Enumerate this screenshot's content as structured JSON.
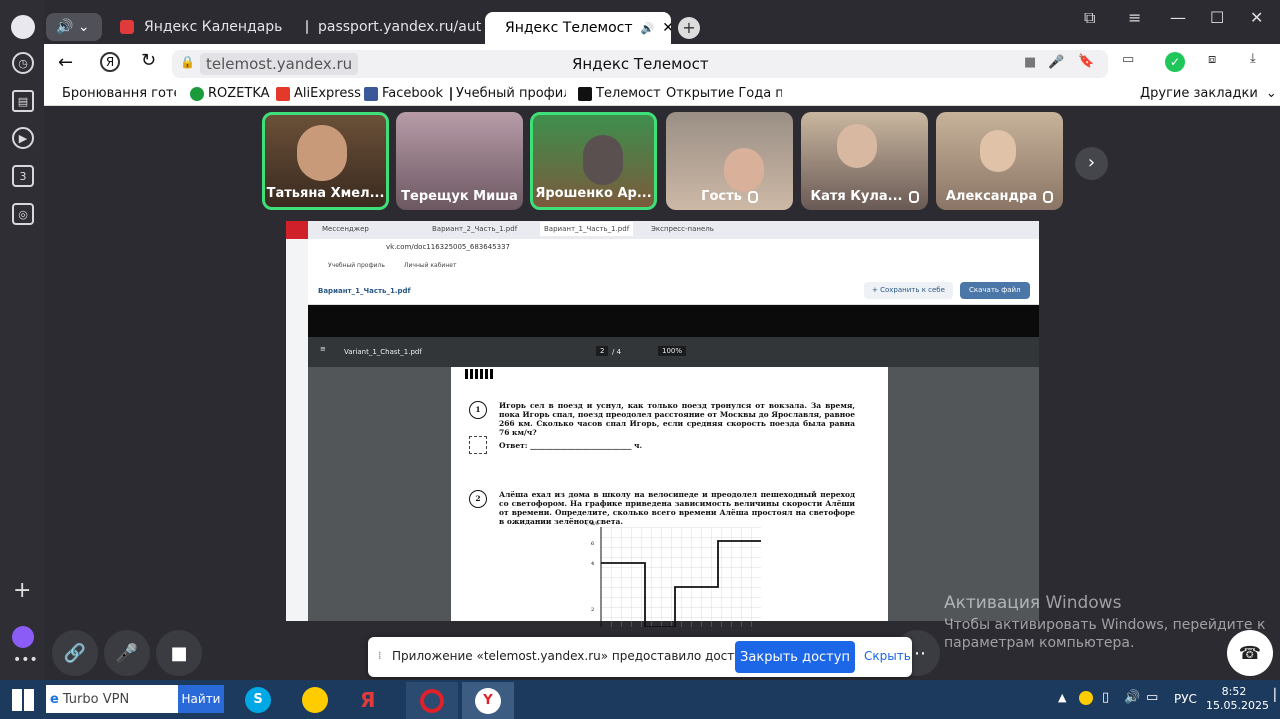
{
  "tabs": [
    {
      "label": "Яндекс Календарь"
    },
    {
      "label": "passport.yandex.ru/auth/"
    },
    {
      "label": "Яндекс Телемост"
    }
  ],
  "nav": {
    "url": "telemost.yandex.ru",
    "page_title": "Яндекс Телемост"
  },
  "bookmarks": {
    "items": [
      "Бронювання готе",
      "ROZETKA",
      "AliExpress",
      "Facebook",
      "Учебный профиль",
      "Телемост",
      "Открытие Года пе"
    ],
    "other": "Другие закладки"
  },
  "participants": [
    {
      "name": "Татьяна Хмел...",
      "speaking": true,
      "muted": false
    },
    {
      "name": "Терещук Миша",
      "speaking": false,
      "muted": false
    },
    {
      "name": "Ярошенко Ар...",
      "speaking": true,
      "muted": false
    },
    {
      "name": "Гость",
      "speaking": false,
      "muted": true
    },
    {
      "name": "Катя Кула...",
      "speaking": false,
      "muted": true
    },
    {
      "name": "Александра",
      "speaking": false,
      "muted": true
    }
  ],
  "shared": {
    "tabs": [
      "Мессенджер",
      "Вариант_2_Часть_1.pdf",
      "Вариант_1_Часть_1.pdf",
      "Экспресс-панель"
    ],
    "url": "vk.com/doc116325005_683645337",
    "bookmarks": [
      "Учебный профиль",
      "Личный кабинет"
    ],
    "doc_title": "Вариант_1_Часть_1.pdf",
    "save_label": "Сохранить к себе",
    "download_label": "Скачать файл",
    "pdf_name": "Variant_1_Chast_1.pdf",
    "page_current": "2",
    "page_total": "/ 4",
    "zoom": "100%",
    "q1_num": "1",
    "q1_text": "Игорь сел в поезд и уснул, как только поезд тронулся от вокзала. За время, пока Игорь спал, поезд преодолел расстояние от Москвы до Ярославля, равное 266 км. Сколько часов спал Игорь, если средняя скорость поезда была равна 76 км/ч?",
    "answer_label": "Ответ: ___________________________ ч.",
    "q2_num": "2",
    "q2_text": "Алёша ехал из дома в школу на велосипеде и преодолел пешеходный переход со светофором. На графике приведена зависимость величины скорости Алёши от времени. Определите, сколько всего времени Алёша простоял на светофоре в ожидании зелёного света.",
    "graph_axis": "v, м/с",
    "graph_ticks": [
      "6",
      "4",
      "2"
    ]
  },
  "notice": {
    "text": "Приложение «telemost.yandex.ru» предоставило доступ к окну.",
    "primary": "Закрыть доступ",
    "secondary": "Скрыть"
  },
  "watermark": {
    "line1": "Активация Windows",
    "line2": "Чтобы активировать Windows, перейдите к",
    "line3": "параметрам компьютера."
  },
  "taskbar": {
    "search": "Turbo VPN",
    "search_btn": "Найти",
    "lang": "РУС",
    "time": "8:52",
    "date": "15.05.2025"
  },
  "colors": {
    "speaking": "#3fe07a",
    "primary": "#1c66e8",
    "vk": "#2d81e0"
  }
}
